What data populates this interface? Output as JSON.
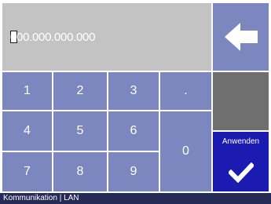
{
  "display": {
    "value": "000.000.000.000"
  },
  "keypad": {
    "keys": [
      "1",
      "2",
      "3",
      ".",
      "4",
      "5",
      "6",
      "0",
      "7",
      "8",
      "9"
    ]
  },
  "actions": {
    "backspace_icon": "arrow-left-icon",
    "apply_label": "Anwenden",
    "apply_icon": "checkmark-icon"
  },
  "statusbar": {
    "text": "Kommunikation | LAN"
  },
  "colors": {
    "key": "#7c86bf",
    "display": "#c3c3c3",
    "blank": "#6f6f6f",
    "apply": "#1b1bb1",
    "statusbar": "#262b55"
  }
}
